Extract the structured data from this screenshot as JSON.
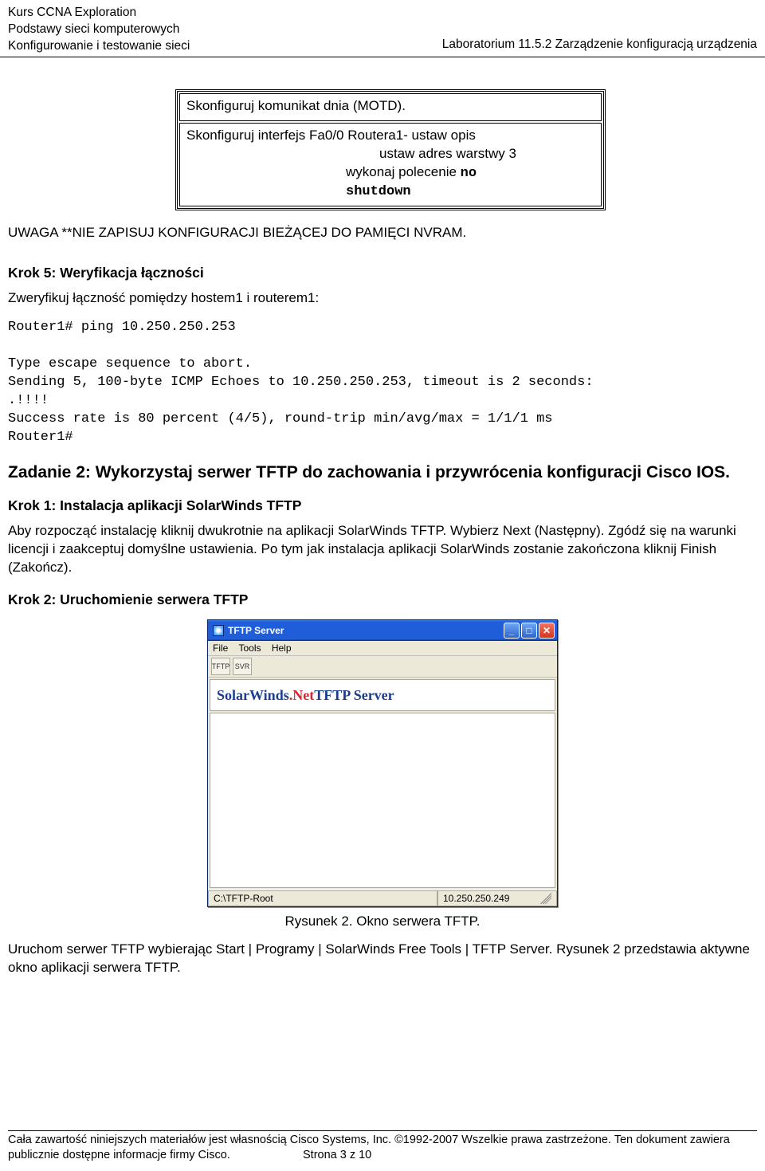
{
  "header": {
    "line1": "Kurs CCNA Exploration",
    "line2": "Podstawy sieci komputerowych",
    "line3": "Konfigurowanie i testowanie sieci",
    "right": "Laboratorium 11.5.2 Zarządzenie konfiguracją urządzenia"
  },
  "box": {
    "row1": "Skonfiguruj komunikat dnia (MOTD).",
    "row2_l1": "Skonfiguruj interfejs Fa0/0 Routera1- ustaw opis",
    "row2_l2": "ustaw adres warstwy 3",
    "row2_l3_pre": "wykonaj polecenie ",
    "row2_l3_cmd": "no",
    "row2_l4_cmd": "shutdown"
  },
  "warn": "UWAGA **NIE ZAPISUJ KONFIGURACJI BIEŻĄCEJ DO PAMIĘCI NVRAM.",
  "step5_title": "Krok 5: Weryfikacja łączności",
  "step5_para": "Zweryfikuj łączność pomiędzy hostem1 i routerem1:",
  "code": "Router1# ping 10.250.250.253\n\nType escape sequence to abort.\nSending 5, 100-byte ICMP Echoes to 10.250.250.253, timeout is 2 seconds:\n.!!!!\nSuccess rate is 80 percent (4/5), round-trip min/avg/max = 1/1/1 ms\nRouter1#",
  "task2_title": "Zadanie 2: Wykorzystaj serwer TFTP do zachowania i przywrócenia konfiguracji Cisco IOS.",
  "krok1_title": "Krok 1: Instalacja aplikacji SolarWinds TFTP",
  "krok1_para": "Aby rozpocząć instalację kliknij dwukrotnie na aplikacji SolarWinds TFTP. Wybierz Next (Następny). Zgódź się na warunki licencji i zaakceptuj domyślne ustawienia. Po tym jak instalacja aplikacji SolarWinds zostanie zakończona kliknij Finish (Zakończ).",
  "krok2_title": "Krok 2: Uruchomienie serwera TFTP",
  "tftp": {
    "title": "TFTP Server",
    "menu_file": "File",
    "menu_tools": "Tools",
    "menu_help": "Help",
    "toolbar_label1": "TFTP",
    "toolbar_label2": "SVR",
    "banner_pre": "SolarWinds",
    "banner_dot": ".Net",
    "banner_post": " TFTP Server",
    "status_left": "C:\\TFTP-Root",
    "status_right": "10.250.250.249"
  },
  "caption": "Rysunek 2. Okno serwera TFTP.",
  "closing": "Uruchom serwer TFTP wybierając Start | Programy | SolarWinds Free Tools | TFTP Server. Rysunek 2 przedstawia aktywne okno aplikacji serwera TFTP.",
  "footer": {
    "line1": "Cała zawartość niniejszych materiałów jest własnością Cisco Systems, Inc. ©1992-2007 Wszelkie prawa zastrzeżone. Ten dokument zawiera",
    "line2_left": "publicznie dostępne informacje firmy Cisco.",
    "line2_right": "Strona 3 z 10"
  }
}
